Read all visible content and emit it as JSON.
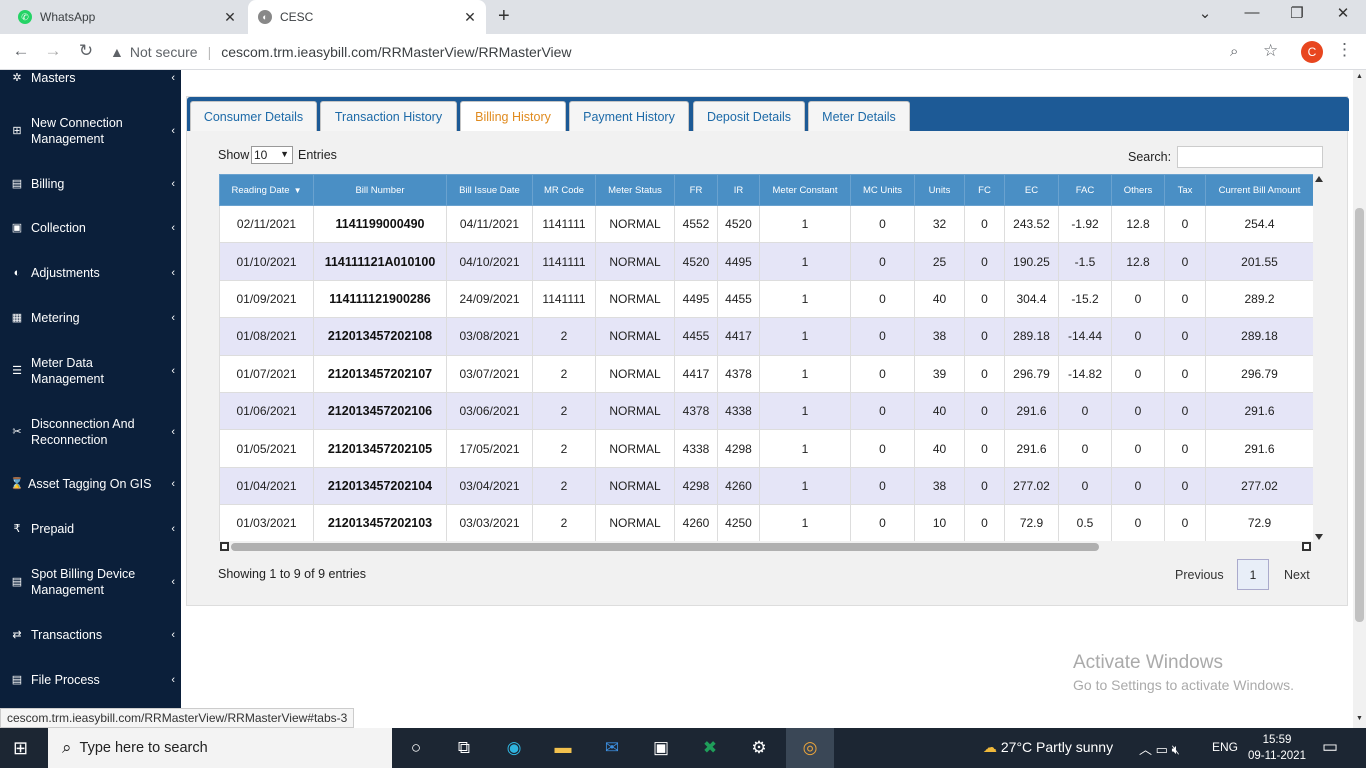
{
  "browser": {
    "tabs": [
      {
        "title": "WhatsApp"
      },
      {
        "title": "CESC"
      }
    ],
    "not_secure": "Not secure",
    "url": "cescom.trm.ieasybill.com/RRMasterView/RRMasterView",
    "profile_initial": "C",
    "status_url": "cescom.trm.ieasybill.com/RRMasterView/RRMasterView#tabs-3"
  },
  "sidebar": {
    "items": [
      {
        "label": "Masters",
        "icon": "gear-icon"
      },
      {
        "label": "New Connection Management",
        "icon": "plus-icon"
      },
      {
        "label": "Billing",
        "icon": "receipt-icon"
      },
      {
        "label": "Collection",
        "icon": "money-icon"
      },
      {
        "label": "Adjustments",
        "icon": "half-circle-icon"
      },
      {
        "label": "Metering",
        "icon": "meter-icon"
      },
      {
        "label": "Meter Data Management",
        "icon": "database-icon"
      },
      {
        "label": "Disconnection And Reconnection",
        "icon": "unlink-icon"
      },
      {
        "label": "Asset Tagging On GIS",
        "icon": "hourglass-icon"
      },
      {
        "label": "Prepaid",
        "icon": "rupee-icon"
      },
      {
        "label": "Spot Billing Device Management",
        "icon": "document-icon"
      },
      {
        "label": "Transactions",
        "icon": "exchange-icon"
      },
      {
        "label": "File Process",
        "icon": "file-icon"
      }
    ]
  },
  "tabs": [
    {
      "label": "Consumer Details"
    },
    {
      "label": "Transaction History"
    },
    {
      "label": "Billing History",
      "active": true
    },
    {
      "label": "Payment History"
    },
    {
      "label": "Deposit Details"
    },
    {
      "label": "Meter Details"
    }
  ],
  "controls": {
    "show_label": "Show",
    "show_value": "10",
    "entries_label": "Entries",
    "search_label": "Search:",
    "search_value": ""
  },
  "table": {
    "columns": [
      "Reading Date",
      "Bill Number",
      "Bill Issue Date",
      "MR Code",
      "Meter Status",
      "FR",
      "IR",
      "Meter Constant",
      "MC Units",
      "Units",
      "FC",
      "EC",
      "FAC",
      "Others",
      "Tax",
      "Current Bill Amount"
    ],
    "rows": [
      [
        "02/11/2021",
        "1141199000490",
        "04/11/2021",
        "1141111",
        "NORMAL",
        "4552",
        "4520",
        "1",
        "0",
        "32",
        "0",
        "243.52",
        "-1.92",
        "12.8",
        "0",
        "254.4"
      ],
      [
        "01/10/2021",
        "114111121A010100",
        "04/10/2021",
        "1141111",
        "NORMAL",
        "4520",
        "4495",
        "1",
        "0",
        "25",
        "0",
        "190.25",
        "-1.5",
        "12.8",
        "0",
        "201.55"
      ],
      [
        "01/09/2021",
        "114111121900286",
        "24/09/2021",
        "1141111",
        "NORMAL",
        "4495",
        "4455",
        "1",
        "0",
        "40",
        "0",
        "304.4",
        "-15.2",
        "0",
        "0",
        "289.2"
      ],
      [
        "01/08/2021",
        "212013457202108",
        "03/08/2021",
        "2",
        "NORMAL",
        "4455",
        "4417",
        "1",
        "0",
        "38",
        "0",
        "289.18",
        "-14.44",
        "0",
        "0",
        "289.18"
      ],
      [
        "01/07/2021",
        "212013457202107",
        "03/07/2021",
        "2",
        "NORMAL",
        "4417",
        "4378",
        "1",
        "0",
        "39",
        "0",
        "296.79",
        "-14.82",
        "0",
        "0",
        "296.79"
      ],
      [
        "01/06/2021",
        "212013457202106",
        "03/06/2021",
        "2",
        "NORMAL",
        "4378",
        "4338",
        "1",
        "0",
        "40",
        "0",
        "291.6",
        "0",
        "0",
        "0",
        "291.6"
      ],
      [
        "01/05/2021",
        "212013457202105",
        "17/05/2021",
        "2",
        "NORMAL",
        "4338",
        "4298",
        "1",
        "0",
        "40",
        "0",
        "291.6",
        "0",
        "0",
        "0",
        "291.6"
      ],
      [
        "01/04/2021",
        "212013457202104",
        "03/04/2021",
        "2",
        "NORMAL",
        "4298",
        "4260",
        "1",
        "0",
        "38",
        "0",
        "277.02",
        "0",
        "0",
        "0",
        "277.02"
      ],
      [
        "01/03/2021",
        "212013457202103",
        "03/03/2021",
        "2",
        "NORMAL",
        "4260",
        "4250",
        "1",
        "0",
        "10",
        "0",
        "72.9",
        "0.5",
        "0",
        "0",
        "72.9"
      ]
    ]
  },
  "pagination": {
    "info": "Showing 1 to 9 of 9 entries",
    "previous": "Previous",
    "page": "1",
    "next": "Next"
  },
  "watermark": {
    "line1": "Activate Windows",
    "line2": "Go to Settings to activate Windows."
  },
  "taskbar": {
    "search_placeholder": "Type here to search",
    "weather": "27°C  Partly sunny",
    "lang": "ENG",
    "time": "15:59",
    "date": "09-11-2021"
  }
}
